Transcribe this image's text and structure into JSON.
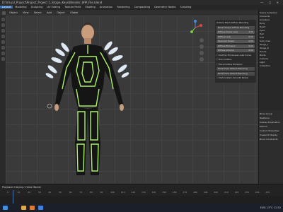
{
  "window": {
    "title": "D:\\Visual_Project\\Project_Project 1_Shape_Keys\\Blender_WIP_File.blend",
    "controls": "— ▢ ✕"
  },
  "menubar": [
    "Layout",
    "Modeling",
    "Sculpting",
    "UV Editing",
    "Texture Paint",
    "Shading",
    "Animation",
    "Rendering",
    "Compositing",
    "Geometry Nodes",
    "Scripting"
  ],
  "toolbar": [
    "Object",
    "View",
    "Select",
    "Add",
    "Object",
    "Global"
  ],
  "viewport_panel": {
    "rows": [
      {
        "type": "label",
        "text": "Outline Mesh Diffuse Blending"
      },
      {
        "type": "btn",
        "text": "Reset Shape Diffuse Blending"
      },
      {
        "type": "field",
        "label": "Diffuse Power Lerp",
        "value": "1.00"
      },
      {
        "type": "field",
        "label": "Diffuse Lerp",
        "value": "0.50"
      },
      {
        "type": "field",
        "label": "Specular Power",
        "value": "0.00"
      },
      {
        "type": "field",
        "label": "Diffuse Emission",
        "value": "0.00"
      },
      {
        "type": "field",
        "label": "Diffuse Volume",
        "value": "0.00"
      },
      {
        "type": "check",
        "text": "Outline Thickness Lines Curve"
      },
      {
        "type": "check",
        "text": "Rim Outline"
      },
      {
        "type": "check",
        "text": "Face Outline Emission"
      },
      {
        "type": "btn",
        "text": "Reset Face Diffuse Blending"
      },
      {
        "type": "btn",
        "text": "Reset Face Diffuse Blending"
      },
      {
        "type": "check",
        "text": "Deformation Smooth Model"
      }
    ]
  },
  "outliner": [
    "Scene Collection",
    "Character",
    "Armature",
    "Body",
    "Head",
    "Eyes",
    "Hair",
    "Suit",
    "Suit_Lines",
    "Wings_L",
    "Wings_R",
    "Hands",
    "Boots",
    "Camera",
    "Light",
    "Collection"
  ],
  "properties": [
    "Bone Group",
    "Relations",
    "Inverse Kinematics",
    "Deform",
    "Custom Properties",
    "Viewport Display",
    "Bone Constraints"
  ],
  "timeline": {
    "labels": "Playback ▾  Keying ▾  View  Marker",
    "ticks": [
      "0",
      "10",
      "20",
      "30",
      "40",
      "50",
      "60",
      "70",
      "80",
      "90",
      "100",
      "110",
      "120",
      "130",
      "140",
      "150",
      "160",
      "170",
      "180",
      "190",
      "200",
      "210",
      "220",
      "230",
      "240",
      "250"
    ],
    "current": "1",
    "start": "1",
    "end": "250"
  },
  "taskbar": {
    "tray": "ENG  13°C  11:52"
  },
  "colors": {
    "accent": "#4772b3",
    "glow": "#b6ff6a"
  }
}
